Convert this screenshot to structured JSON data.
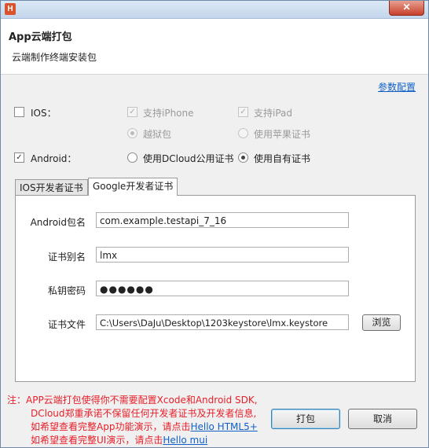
{
  "window": {
    "icon_text": "H",
    "close_glyph": "✕"
  },
  "header": {
    "title": "App云端打包",
    "subtitle": "云端制作终端安装包"
  },
  "config_link": "参数配置",
  "ios": {
    "label": "IOS：",
    "checked": false,
    "support_iphone": "支持iPhone",
    "support_ipad": "支持iPad",
    "jailbreak": "越狱包",
    "apple_cert": "使用苹果证书"
  },
  "android": {
    "label": "Android：",
    "checked": true,
    "dcloud_cert": "使用DCloud公用证书",
    "own_cert": "使用自有证书"
  },
  "tabs": [
    {
      "label": "IOS开发者证书"
    },
    {
      "label": "Google开发者证书"
    }
  ],
  "form": {
    "package_label": "Android包名",
    "package_value": "com.example.testapi_7_16",
    "alias_label": "证书别名",
    "alias_value": "lmx",
    "password_label": "私钥密码",
    "password_value": "●●●●●●",
    "file_label": "证书文件",
    "file_value": "C:\\Users\\DaJu\\Desktop\\1203keystore\\lmx.keystore",
    "browse_label": "浏览"
  },
  "note": {
    "line1": "注：APP云端打包使得你不需要配置Xcode和Android SDK,",
    "line2": "DCloud郑重承诺不保留任何开发者证书及开发者信息,",
    "line3_prefix": "如希望查看完整App功能演示，请点击",
    "line3_link": "Hello HTML5+",
    "line4_prefix": "如希望查看完整UI演示，请点击",
    "line4_link": "Hello mui"
  },
  "buttons": {
    "pack": "打包",
    "cancel": "取消"
  }
}
